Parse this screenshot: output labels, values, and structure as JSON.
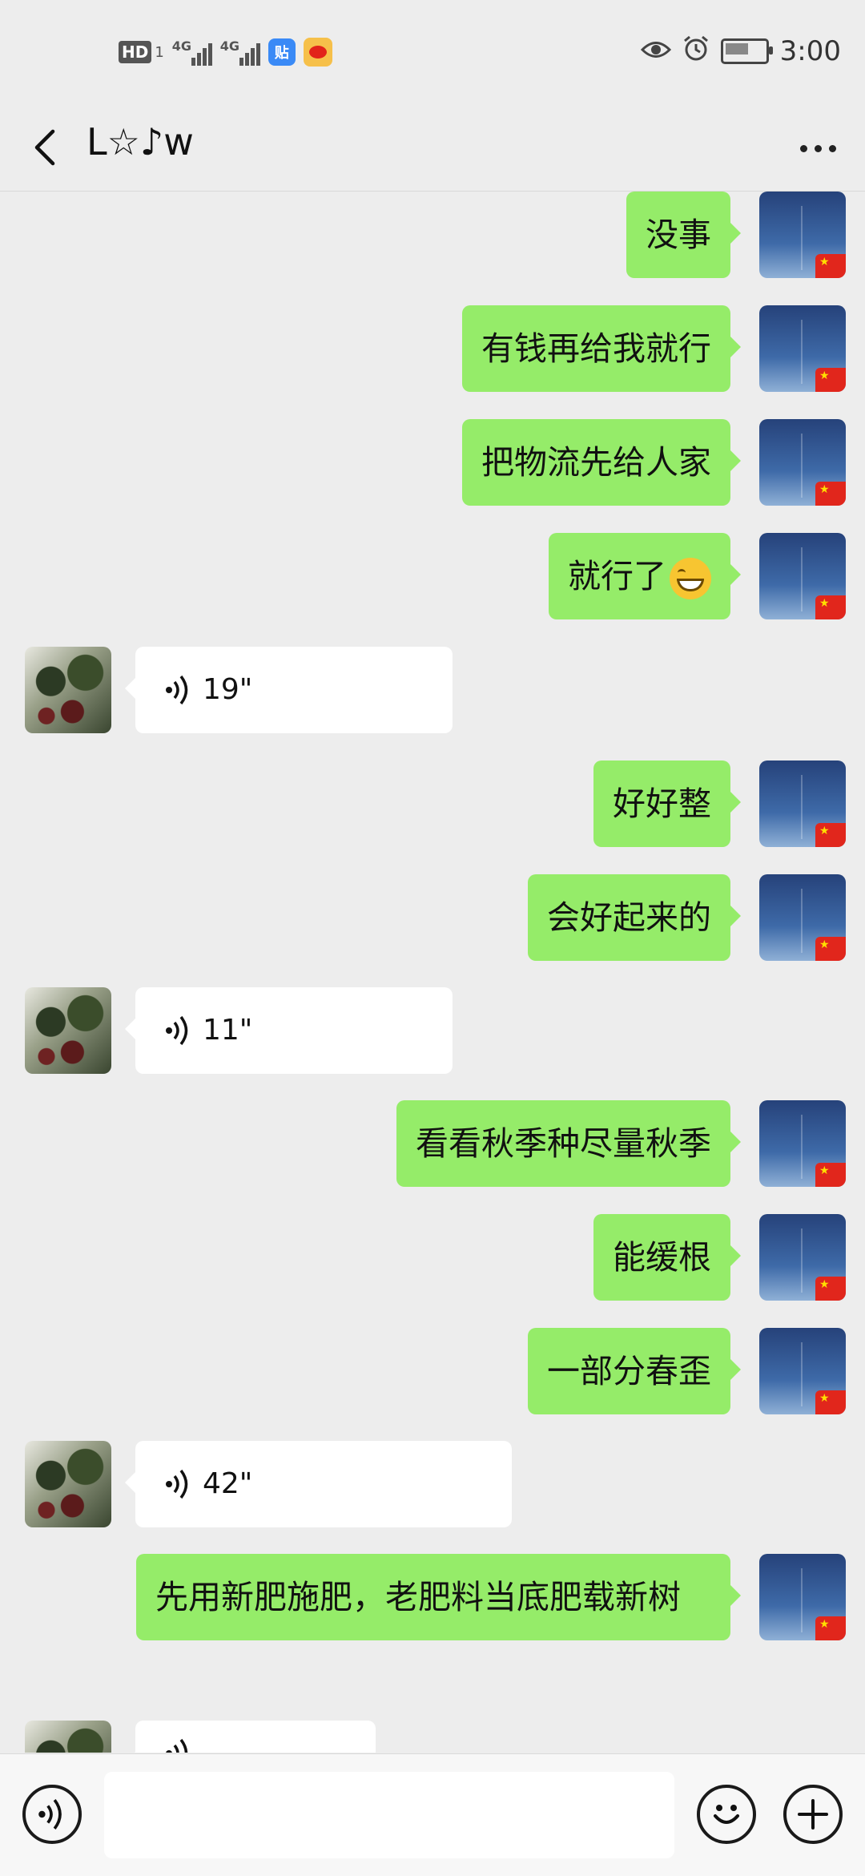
{
  "status_bar": {
    "time": "3:00",
    "hd_badge": "HD",
    "sim1": "1",
    "net1": "4G",
    "net2": "4G",
    "tieba_label": "贴"
  },
  "header": {
    "title": "L☆♪w"
  },
  "messages": [
    {
      "from": "me",
      "text": "没事"
    },
    {
      "from": "me",
      "text": "有钱再给我就行"
    },
    {
      "from": "me",
      "text": "把物流先给人家"
    },
    {
      "from": "me",
      "text": "就行了"
    },
    {
      "from": "them",
      "type": "voice",
      "duration": "19\""
    },
    {
      "from": "me",
      "text": "好好整"
    },
    {
      "from": "me",
      "text": "会好起来的"
    },
    {
      "from": "them",
      "type": "voice",
      "duration": "11\""
    },
    {
      "from": "me",
      "text": "看看秋季种尽量秋季"
    },
    {
      "from": "me",
      "text": "能缓根"
    },
    {
      "from": "me",
      "text": "一部分春歪"
    },
    {
      "from": "them",
      "type": "voice",
      "duration": "42\""
    },
    {
      "from": "me",
      "text": "先用新肥施肥，老肥料当底肥载新树"
    },
    {
      "from": "them",
      "type": "voice",
      "duration": ""
    }
  ],
  "icons": {
    "back": "back-arrow-icon",
    "more": "more-dots-icon",
    "voice": "voice-icon",
    "emoji": "emoji-icon",
    "plus": "plus-icon"
  }
}
